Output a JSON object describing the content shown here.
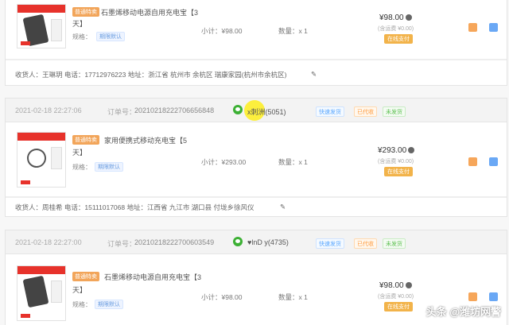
{
  "orders": [
    {
      "item": {
        "badge": "普通特卖",
        "title_line1": "石墨烯移动电源自用充电宝【3",
        "title_line2": "天】",
        "spec_label": "规格：",
        "spec_value": "期限默认",
        "subtotal": "小计：¥98.00",
        "qty": "数量：x 1",
        "price": "¥98.00",
        "shipping": "(含运费 ¥0.00)",
        "pay_status": "在线支付"
      },
      "address": "收货人：王琳玥 电话：17712976223 地址：浙江省 杭州市 余杭区 瑞康家园(杭州市余杭区)"
    },
    {
      "header": {
        "time": "2021-02-18 22:27:06",
        "order_no_label": "订单号：",
        "order_no": "20210218222706656848",
        "buyer": "x刺洲(5051)",
        "tag1": "快速发货",
        "tag2": "已代收",
        "tag3": "未发货"
      },
      "item": {
        "badge": "普通特卖",
        "title_line1": "家用便携式移动充电宝【5",
        "title_line2": "天】",
        "spec_label": "规格：",
        "spec_value": "期限默认",
        "subtotal": "小计：¥293.00",
        "qty": "数量：x 1",
        "price": "¥293.00",
        "shipping": "(含运费 ¥0.00)",
        "pay_status": "在线支付"
      },
      "address": "收货人：周桂希 电话：15111017068 地址：江西省 九江市 湖口县 付垅乡徐风仪"
    },
    {
      "header": {
        "time": "2021-02-18 22:27:00",
        "order_no_label": "订单号：",
        "order_no": "20210218222700603549",
        "buyer": "♥lnD y(4735)",
        "tag1": "快速发货",
        "tag2": "已代收",
        "tag3": "未发货"
      },
      "item": {
        "badge": "普通特卖",
        "title_line1": "石墨烯移动电源自用充电宝【3",
        "title_line2": "天】",
        "spec_label": "规格：",
        "spec_value": "期限默认",
        "subtotal": "小计：¥98.00",
        "qty": "数量：x 1",
        "price": "¥98.00",
        "shipping": "(含运费 ¥0.00)",
        "pay_status": "在线支付"
      }
    }
  ],
  "watermark": "头条 @潍坊网警",
  "colors": {
    "badge": "#f2a55a",
    "pay": "#f2b34a",
    "wechat": "#3cb034",
    "banner": "#e7322b"
  },
  "icons": [
    "wechat-icon",
    "edit-icon",
    "info-icon",
    "action-icon"
  ]
}
